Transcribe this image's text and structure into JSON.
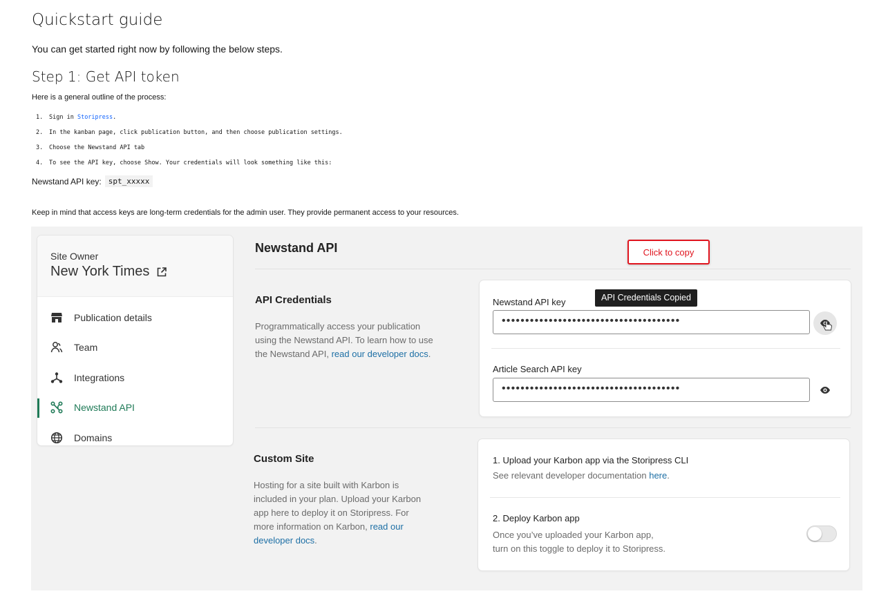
{
  "guide": {
    "title": "Quickstart guide",
    "intro": "You can get started right now by following the below steps.",
    "step1_title": "Step 1: Get API token",
    "outline": "Here is a general outline of the process:",
    "steps": [
      {
        "num": "1.",
        "text_before": "Sign in ",
        "link": "Storipress",
        "text_after": "."
      },
      {
        "num": "2.",
        "text": "In the kanban page, click publication button, and then choose publication settings."
      },
      {
        "num": "3.",
        "text": "Choose the Newstand API tab"
      },
      {
        "num": "4.",
        "text": "To see the API key, choose Show. Your credentials will look something like this:"
      }
    ],
    "key_label": "Newstand API key:",
    "key_example": "spt_xxxxx",
    "note": "Keep in mind that access keys are long-term credentials for the admin user. They provide permanent access to your resources."
  },
  "sidebar": {
    "owner_label": "Site Owner",
    "owner_name": "New York Times",
    "items": [
      {
        "label": "Publication details",
        "icon": "storefront-icon"
      },
      {
        "label": "Team",
        "icon": "team-icon"
      },
      {
        "label": "Integrations",
        "icon": "integrations-icon"
      },
      {
        "label": "Newstand API",
        "icon": "api-icon",
        "active": true
      },
      {
        "label": "Domains",
        "icon": "globe-icon"
      }
    ]
  },
  "main": {
    "title": "Newstand API",
    "callout": "Click to copy",
    "credentials": {
      "title": "API Credentials",
      "desc": "Programmatically access your publication using the Newstand API. To learn how to use the Newstand API, ",
      "link": "read our developer docs",
      "desc_end": ".",
      "newstand_label": "Newstand API key",
      "newstand_value": "••••••••••••••••••••••••••••••••••••••",
      "tooltip": "API Credentials Copied",
      "article_label": "Article Search API key",
      "article_value": "••••••••••••••••••••••••••••••••••••••"
    },
    "custom_site": {
      "title": "Custom Site",
      "desc": "Hosting for a site built with Karbon is included in your plan. Upload your Karbon app here to deploy it on Storipress. For more information on Karbon, ",
      "link": "read our developer docs",
      "desc_end": ".",
      "step1_title": "1. Upload your Karbon app via the Storipress CLI",
      "step1_desc": "See relevant developer documentation ",
      "step1_link": "here",
      "step1_end": ".",
      "step2_title": "2. Deploy Karbon app",
      "step2_desc_line1": "Once you’ve uploaded your Karbon app,",
      "step2_desc_line2": "turn on this toggle to deploy it to Storipress.",
      "deploy_toggle_on": false
    }
  },
  "colors": {
    "accent": "#1f7a57",
    "link": "#1d6fa5",
    "callout": "#e0141e",
    "panel_bg": "#f2f2f2"
  }
}
